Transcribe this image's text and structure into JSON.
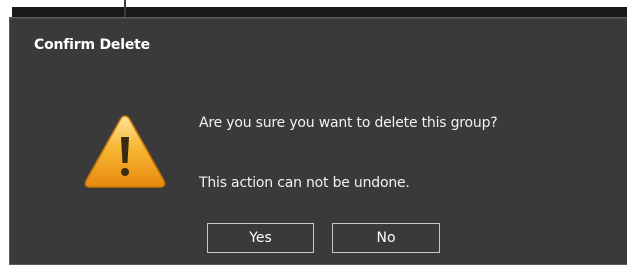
{
  "dialog": {
    "title": "Confirm Delete",
    "icon": "warning-icon",
    "message_line1": "Are you sure you want to delete this group?",
    "message_line2": "This action can not be undone.",
    "yes_label": "Yes",
    "no_label": "No"
  },
  "colors": {
    "dialog_background": "#3a3a3a",
    "text": "#ffffff",
    "warning_orange": "#f2a418",
    "button_border": "#c8c8c8"
  }
}
